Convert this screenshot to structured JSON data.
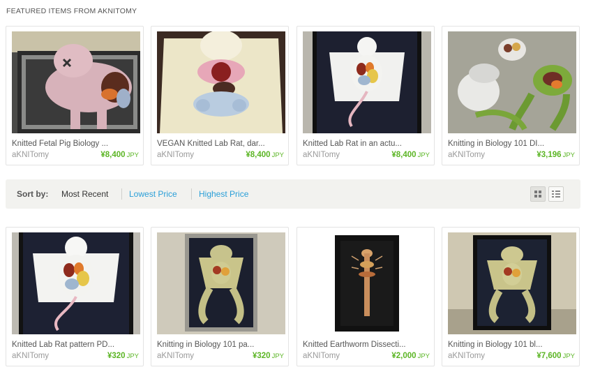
{
  "section_title": "FEATURED ITEMS FROM AKNITOMY",
  "featured": [
    {
      "title": "Knitted Fetal Pig Biology ...",
      "shop": "aKNITomy",
      "price": "¥8,400",
      "currency": "JPY"
    },
    {
      "title": "VEGAN Knitted Lab Rat, dar...",
      "shop": "aKNITomy",
      "price": "¥8,400",
      "currency": "JPY"
    },
    {
      "title": "Knitted Lab Rat in an actu...",
      "shop": "aKNITomy",
      "price": "¥8,400",
      "currency": "JPY"
    },
    {
      "title": "Knitting in Biology 101 DI...",
      "shop": "aKNITomy",
      "price": "¥3,196",
      "currency": "JPY"
    }
  ],
  "sortbar": {
    "label": "Sort by:",
    "options": [
      "Most Recent",
      "Lowest Price",
      "Highest Price"
    ],
    "active": "Most Recent",
    "view_icons": [
      "grid-view-icon",
      "list-view-icon"
    ]
  },
  "listing": [
    {
      "title": "Knitted Lab Rat pattern PD...",
      "shop": "aKNITomy",
      "price": "¥320",
      "currency": "JPY"
    },
    {
      "title": "Knitting in Biology 101 pa...",
      "shop": "aKNITomy",
      "price": "¥320",
      "currency": "JPY"
    },
    {
      "title": "Knitted Earthworm Dissecti...",
      "shop": "aKNITomy",
      "price": "¥2,000",
      "currency": "JPY"
    },
    {
      "title": "Knitting in Biology 101 bl...",
      "shop": "aKNITomy",
      "price": "¥7,600",
      "currency": "JPY"
    }
  ],
  "colors": {
    "price": "#5bb524",
    "link": "#2a9fd8",
    "sortbar_bg": "#f2f2ef"
  }
}
